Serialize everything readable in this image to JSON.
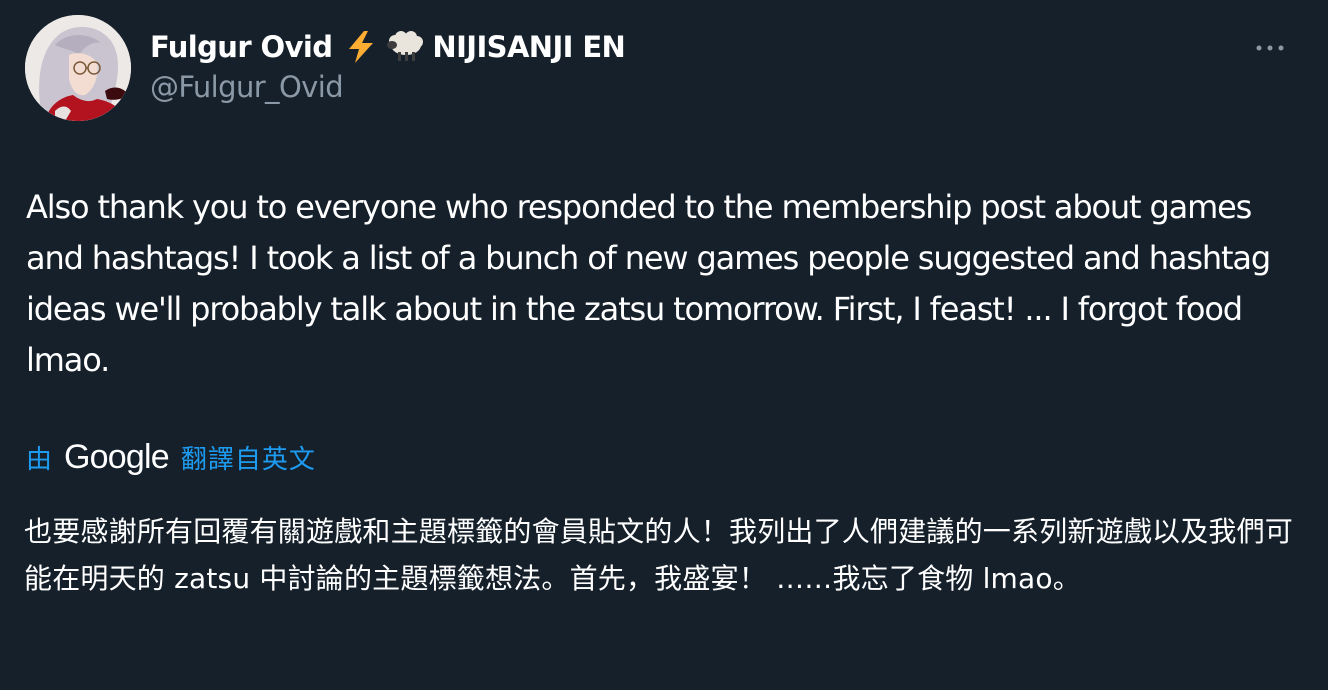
{
  "tweet": {
    "author": {
      "display_name": "Fulgur Ovid",
      "org": "NIJISANJI EN",
      "handle": "@Fulgur_Ovid",
      "emojis": [
        "lightning-emoji",
        "sheep-emoji"
      ]
    },
    "more_icon": "more-horizontal-icon",
    "text": "Also thank you to everyone who responded to the membership post about games and hashtags! I took a list of a bunch of new games people suggested and hashtag ideas we'll probably talk about in the zatsu tomorrow. First, I feast! ... I forgot food lmao.",
    "translation": {
      "by_label": "由",
      "provider": "Google",
      "from_label": "翻譯自英文",
      "text": "也要感謝所有回覆有關遊戲和主題標籤的會員貼文的人！我列出了人們建議的一系列新遊戲以及我們可能在明天的 zatsu 中討論的主題標籤想法。首先，我盛宴！ ……我忘了食物 lmao。"
    }
  },
  "colors": {
    "background": "#15202b",
    "primary_text": "#ffffff",
    "secondary_text": "#8b98a5",
    "link": "#1d9bf0"
  }
}
